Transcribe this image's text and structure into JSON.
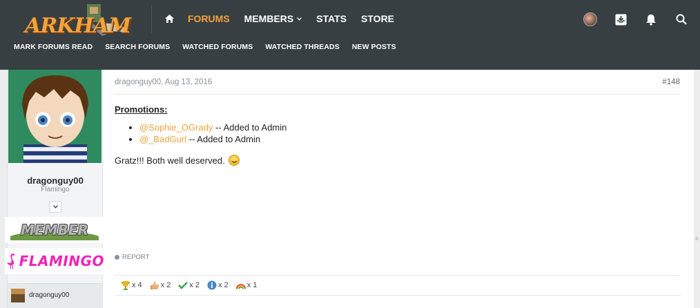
{
  "header": {
    "logo_text": "ARKHAM",
    "nav": [
      {
        "label": "FORUMS",
        "active": true,
        "dropdown": false
      },
      {
        "label": "MEMBERS",
        "active": false,
        "dropdown": true
      },
      {
        "label": "STATS",
        "active": false,
        "dropdown": false
      },
      {
        "label": "STORE",
        "active": false,
        "dropdown": false
      }
    ],
    "subnav": [
      "MARK FORUMS READ",
      "SEARCH FORUMS",
      "WATCHED FORUMS",
      "WATCHED THREADS",
      "NEW POSTS"
    ],
    "icons": [
      "user-avatar",
      "inbox-icon",
      "bell-icon",
      "search-icon"
    ]
  },
  "post": {
    "user": {
      "name": "dragonguy00",
      "title": "Flamingo",
      "badges": [
        "MEMBER",
        "FLAMINGO"
      ],
      "footer_name": "dragonguy00"
    },
    "meta": "dragonguy00, Aug 13, 2016",
    "number": "#148",
    "promotions_title": "Promotions:",
    "promotions": [
      {
        "mention": "@Sophie_OGrady",
        "text": " -- Added to Admin"
      },
      {
        "mention": "@_BadGurl",
        "text": " -- Added to Admin"
      }
    ],
    "message": "Gratz!!! Both well deserved.",
    "report_label": "REPORT",
    "reactions": [
      {
        "icon": "trophy-icon",
        "count": "x 4"
      },
      {
        "icon": "thumbs-up-icon",
        "count": "x 2"
      },
      {
        "icon": "checkmark-icon",
        "count": "x 2"
      },
      {
        "icon": "info-icon",
        "count": "x 2"
      },
      {
        "icon": "rainbow-icon",
        "count": "x 1"
      }
    ]
  },
  "colors": {
    "header_bg": "#373f43",
    "accent": "#f5a23b",
    "flamingo_pink": "#ef24b8"
  }
}
